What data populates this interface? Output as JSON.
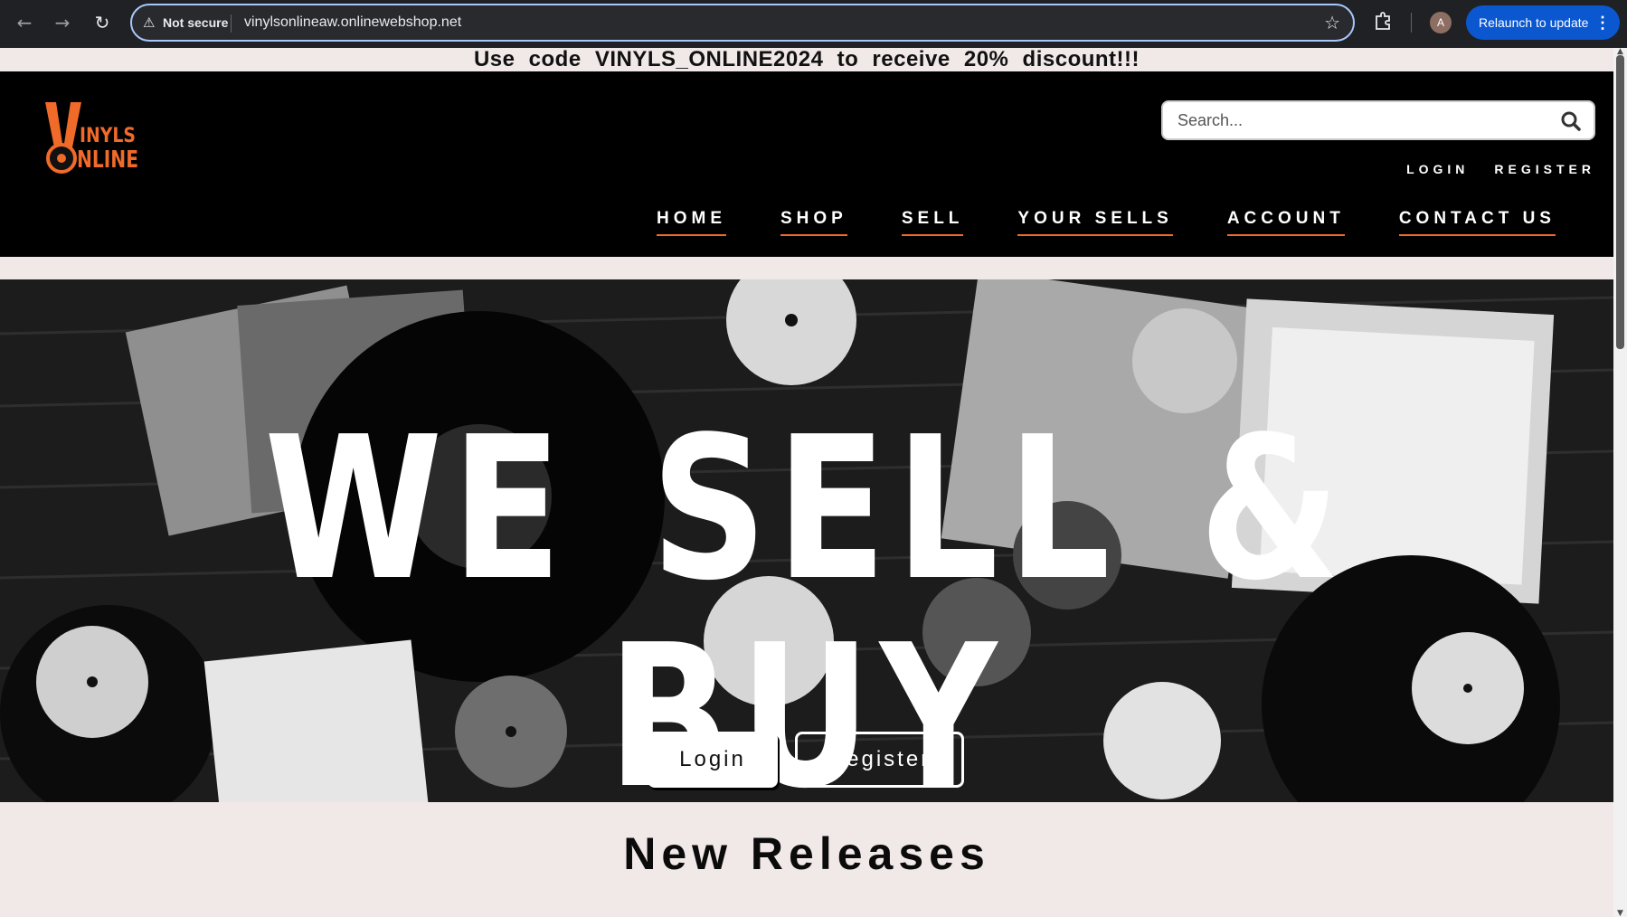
{
  "browser": {
    "security_label": "Not secure",
    "url": "vinylsonlineaw.onlinewebshop.net",
    "avatar_letter": "A",
    "relaunch_label": "Relaunch to update",
    "icons": [
      "back-arrow-icon",
      "forward-arrow-icon",
      "reload-icon",
      "warning-icon",
      "star-icon",
      "extensions-icon",
      "kebab-menu-icon"
    ]
  },
  "promo": {
    "text": "Use code VINYLS_ONLINE2024 to receive 20% discount!!!"
  },
  "header": {
    "logo_alt": "Vinyls Online",
    "logo_line1": "INYLS",
    "logo_line2": "NLINE",
    "search_placeholder": "Search...",
    "auth_links": [
      "LOGIN",
      "REGISTER"
    ],
    "nav": [
      "HOME",
      "SHOP",
      "SELL",
      "YOUR SELLS",
      "ACCOUNT",
      "CONTACT US"
    ]
  },
  "hero": {
    "title": "WE SELL & BUY",
    "login_label": "Login",
    "register_label": "Register"
  },
  "sections": {
    "new_releases_title": "New Releases"
  },
  "colors": {
    "accent_orange": "#f06a2a",
    "header_bg": "#000000",
    "page_bg": "#f1e9e8",
    "chrome_bg": "#202124",
    "relaunch_blue": "#0b57d0"
  }
}
